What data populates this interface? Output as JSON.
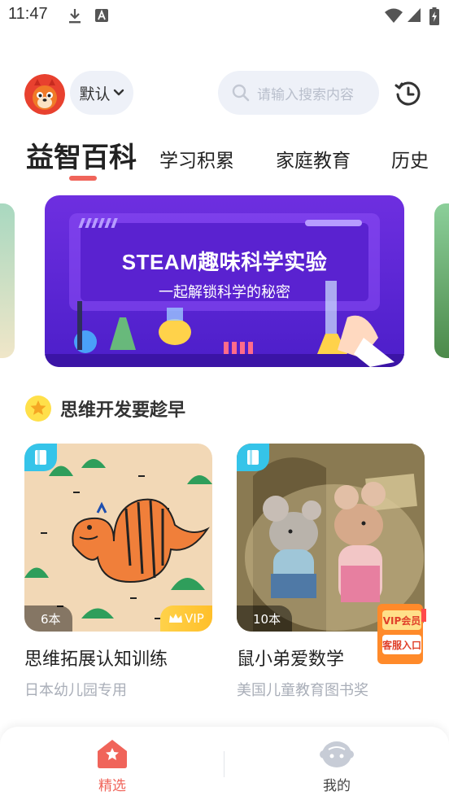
{
  "status_bar": {
    "time": "11:47"
  },
  "header": {
    "mode_label": "默认",
    "search_placeholder": "请输入搜索内容"
  },
  "tabs": [
    {
      "label": "益智百科",
      "active": true
    },
    {
      "label": "学习积累",
      "active": false
    },
    {
      "label": "家庭教育",
      "active": false
    },
    {
      "label": "历史",
      "active": false
    }
  ],
  "banner": {
    "title": "STEAM趣味科学实验",
    "subtitle": "一起解锁科学的秘密"
  },
  "section": {
    "title": "思维开发要趁早"
  },
  "cards": [
    {
      "count": "6本",
      "vip": "VIP",
      "title": "思维拓展认知训练",
      "subtitle": "日本幼儿园专用"
    },
    {
      "count": "10本",
      "title": "鼠小弟爱数学",
      "subtitle": "美国儿童教育图书奖"
    }
  ],
  "vip_entry": {
    "line1": "VIP会员",
    "line2": "客服入口"
  },
  "bottom_nav": [
    {
      "label": "精选",
      "active": true
    },
    {
      "label": "我的",
      "active": false
    }
  ],
  "colors": {
    "accent": "#f0645a",
    "badge_blue": "#35c4e9",
    "vip_gold": "#ffc63a"
  }
}
